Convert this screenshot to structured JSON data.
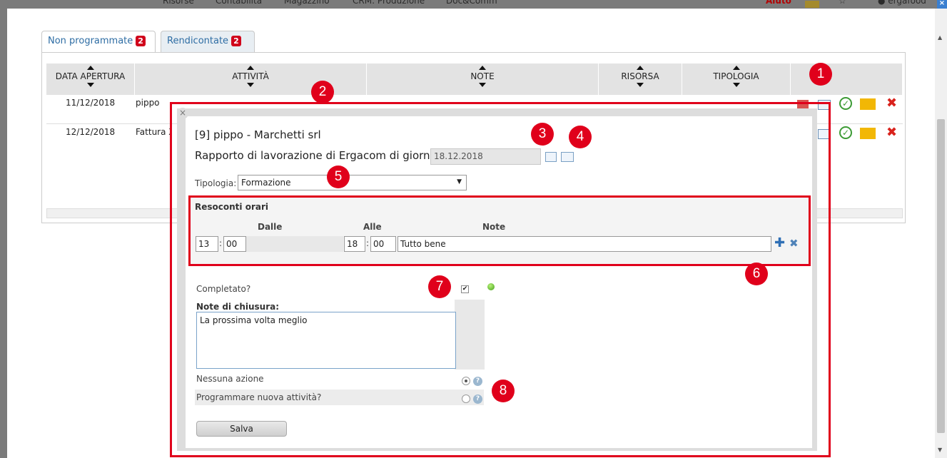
{
  "topnav": {
    "items": [
      "Risorse",
      "Contabilità",
      "Magazzino",
      "CRM: Produzione",
      "Doc&Comm"
    ],
    "help": "Aiuto",
    "user": "ergafood"
  },
  "tabs": [
    {
      "label": "Non programmate",
      "count": "2"
    },
    {
      "label": "Rendicontate",
      "count": "2"
    }
  ],
  "table": {
    "headers": [
      "DATA APERTURA",
      "ATTIVITÀ",
      "NOTE",
      "RISORSA",
      "TIPOLOGIA"
    ],
    "rows": [
      {
        "date": "11/12/2018",
        "activity": "pippo"
      },
      {
        "date": "12/12/2018",
        "activity": "Fattura X"
      }
    ]
  },
  "dialog": {
    "title": "[9] pippo - Marchetti srl",
    "subtitle": "Rapporto di lavorazione di Ergacom di giorno",
    "date": "18.12.2018",
    "tipologia_label": "Tipologia:",
    "tipologia_value": "Formazione",
    "resoconti_title": "Resoconti orari",
    "col_dalle": "Dalle",
    "col_alle": "Alle",
    "col_note": "Note",
    "from_h": "13",
    "from_m": "00",
    "to_h": "18",
    "to_m": "00",
    "note_value": "Tutto bene",
    "completato_label": "Completato?",
    "note_chiusura_label": "Note di chiusura:",
    "note_chiusura_value": "La prossima volta meglio",
    "option1": "Nessuna azione",
    "option2": "Programmare nuova attività?",
    "save_label": "Salva"
  },
  "callouts": [
    "1",
    "2",
    "3",
    "4",
    "5",
    "6",
    "7",
    "8"
  ],
  "colors": {
    "accent": "#e0001b",
    "link": "#2e6da4"
  }
}
